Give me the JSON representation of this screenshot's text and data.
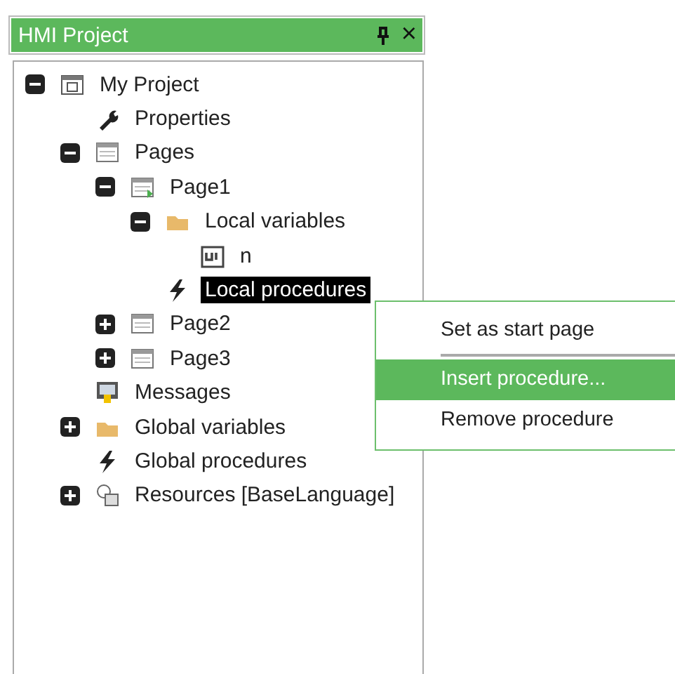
{
  "panel": {
    "title": "HMI Project",
    "close": "×"
  },
  "tree": [
    {
      "label": "My Project",
      "kind": "project",
      "selected": false,
      "expanded": true,
      "children": [
        {
          "label": "Properties",
          "kind": "wrench",
          "selected": false
        },
        {
          "label": "Pages",
          "kind": "page",
          "selected": false,
          "expanded": true,
          "children": [
            {
              "label": "Page1",
              "kind": "page-start",
              "selected": false,
              "expanded": true,
              "children": [
                {
                  "label": "Local variables",
                  "kind": "folder",
                  "selected": false,
                  "expanded": true,
                  "children": [
                    {
                      "label": "n",
                      "kind": "variable",
                      "selected": false
                    }
                  ]
                },
                {
                  "label": "Local procedures",
                  "kind": "bolt",
                  "selected": true
                }
              ]
            },
            {
              "label": "Page2",
              "kind": "page",
              "selected": false,
              "expanded": false
            },
            {
              "label": "Page3",
              "kind": "page",
              "selected": false,
              "expanded": false
            }
          ]
        },
        {
          "label": "Messages",
          "kind": "messages",
          "selected": false
        },
        {
          "label": "Global variables",
          "kind": "folder",
          "selected": false,
          "expanded": false
        },
        {
          "label": "Global procedures",
          "kind": "bolt",
          "selected": false
        },
        {
          "label": "Resources [BaseLanguage]",
          "kind": "resources",
          "selected": false,
          "expanded": false
        }
      ]
    }
  ],
  "context_menu": [
    {
      "label": "Set as start page",
      "selected": false,
      "separator_after": true
    },
    {
      "label": "Insert procedure...",
      "selected": true,
      "separator_after": false
    },
    {
      "label": "Remove procedure",
      "selected": false,
      "separator_after": false
    }
  ]
}
